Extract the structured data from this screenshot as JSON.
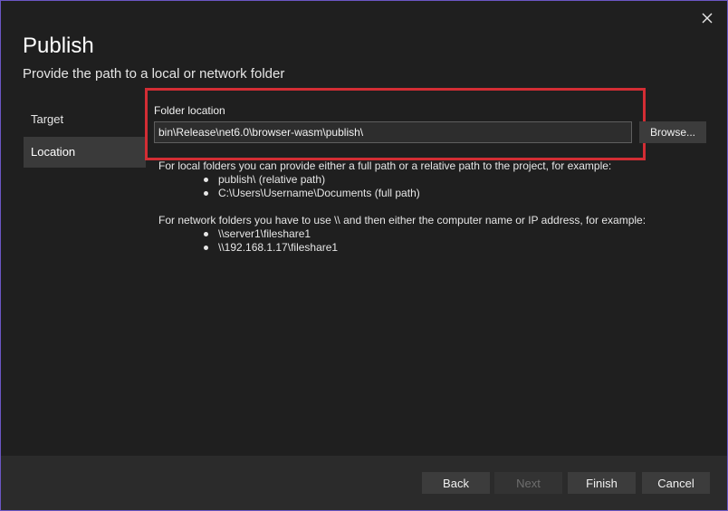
{
  "dialog": {
    "title": "Publish",
    "subtitle": "Provide the path to a local or network folder",
    "close_icon": "close-icon"
  },
  "nav": {
    "items": [
      {
        "label": "Target",
        "selected": false
      },
      {
        "label": "Location",
        "selected": true
      }
    ]
  },
  "folder": {
    "label": "Folder location",
    "value": "bin\\Release\\net6.0\\browser-wasm\\publish\\",
    "browse_label": "Browse..."
  },
  "help": {
    "local_intro": "For local folders you can provide either a full path or a relative path to the project, for example:",
    "local_examples": [
      "publish\\ (relative path)",
      "C:\\Users\\Username\\Documents (full path)"
    ],
    "network_intro": "For network folders you have to use \\\\ and then either the computer name or IP address, for example:",
    "network_examples": [
      "\\\\server1\\fileshare1",
      "\\\\192.168.1.17\\fileshare1"
    ]
  },
  "footer": {
    "back_label": "Back",
    "next_label": "Next",
    "finish_label": "Finish",
    "cancel_label": "Cancel"
  },
  "colors": {
    "background": "#1f1f1f",
    "highlight": "#d32d34",
    "window_border": "#6b56c4",
    "selected_nav": "#3a3a3a"
  }
}
